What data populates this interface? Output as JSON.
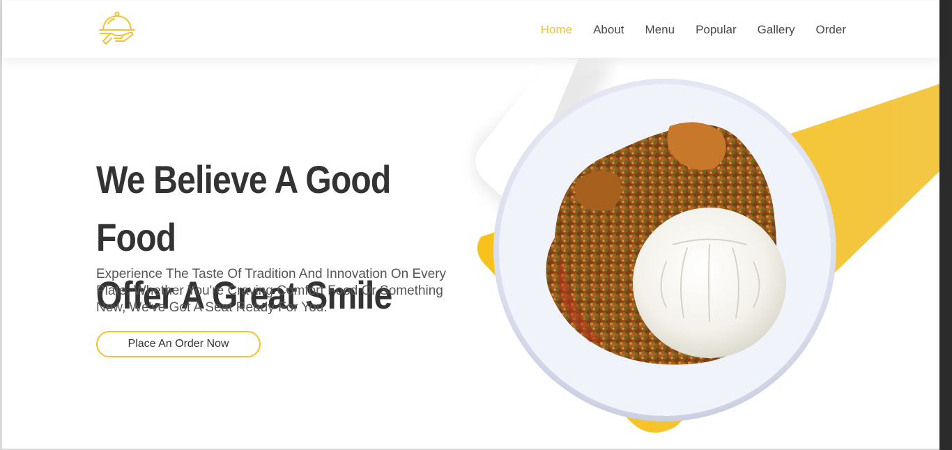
{
  "header": {
    "logo_icon": "cloche-serving-icon",
    "nav": [
      {
        "label": "Home",
        "active": true
      },
      {
        "label": "About",
        "active": false
      },
      {
        "label": "Menu",
        "active": false
      },
      {
        "label": "Popular",
        "active": false
      },
      {
        "label": "Gallery",
        "active": false
      },
      {
        "label": "Order",
        "active": false
      }
    ]
  },
  "hero": {
    "title_line1": "We Believe A Good Food",
    "title_line2": "Offer A Great Smile",
    "description": "Experience The Taste Of Tradition And Innovation On Every Plate. Whether You're Craving Comfort Food Or Something New, We've Got A Seat Ready For You.",
    "cta_label": "Place An Order Now",
    "image_icon": "food-bowl-image"
  },
  "colors": {
    "accent": "#f5c12e",
    "text_dark": "#333333",
    "text_body": "#555555",
    "nav_text": "#4a4a4a"
  }
}
